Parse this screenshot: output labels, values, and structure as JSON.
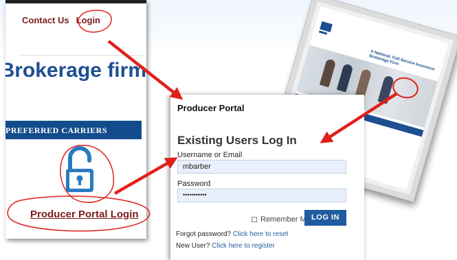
{
  "site": {
    "nav": {
      "contact_label": "Contact Us",
      "login_label": "Login"
    },
    "firm_name_fragment": "Brokerage firm",
    "carriers_fragment": "PREFERRED CARRIERS",
    "portal_login_link": "Producer Portal Login"
  },
  "login": {
    "portal_title": "Producer Portal",
    "heading": "Existing Users Log In",
    "username_label": "Username or Email",
    "username_value": "mbarber",
    "password_label": "Password",
    "password_value": "•••••••••••",
    "remember_label": "Remember Me",
    "login_button": "LOG IN",
    "forgot_prefix": "Forgot password?",
    "forgot_link": "Click here to reset",
    "newuser_prefix": "New User?",
    "newuser_link": "Click here to register"
  },
  "thumbnail": {
    "tagline": "A National, Full-Service Insurance Brokerage Firm"
  },
  "colors": {
    "brand_blue": "#1d4f91",
    "button_blue": "#1f5b9f",
    "maroon": "#7a1d1a",
    "annotation_red": "#e0201b"
  },
  "icons": {
    "lock": "unlocked-padlock-icon"
  }
}
